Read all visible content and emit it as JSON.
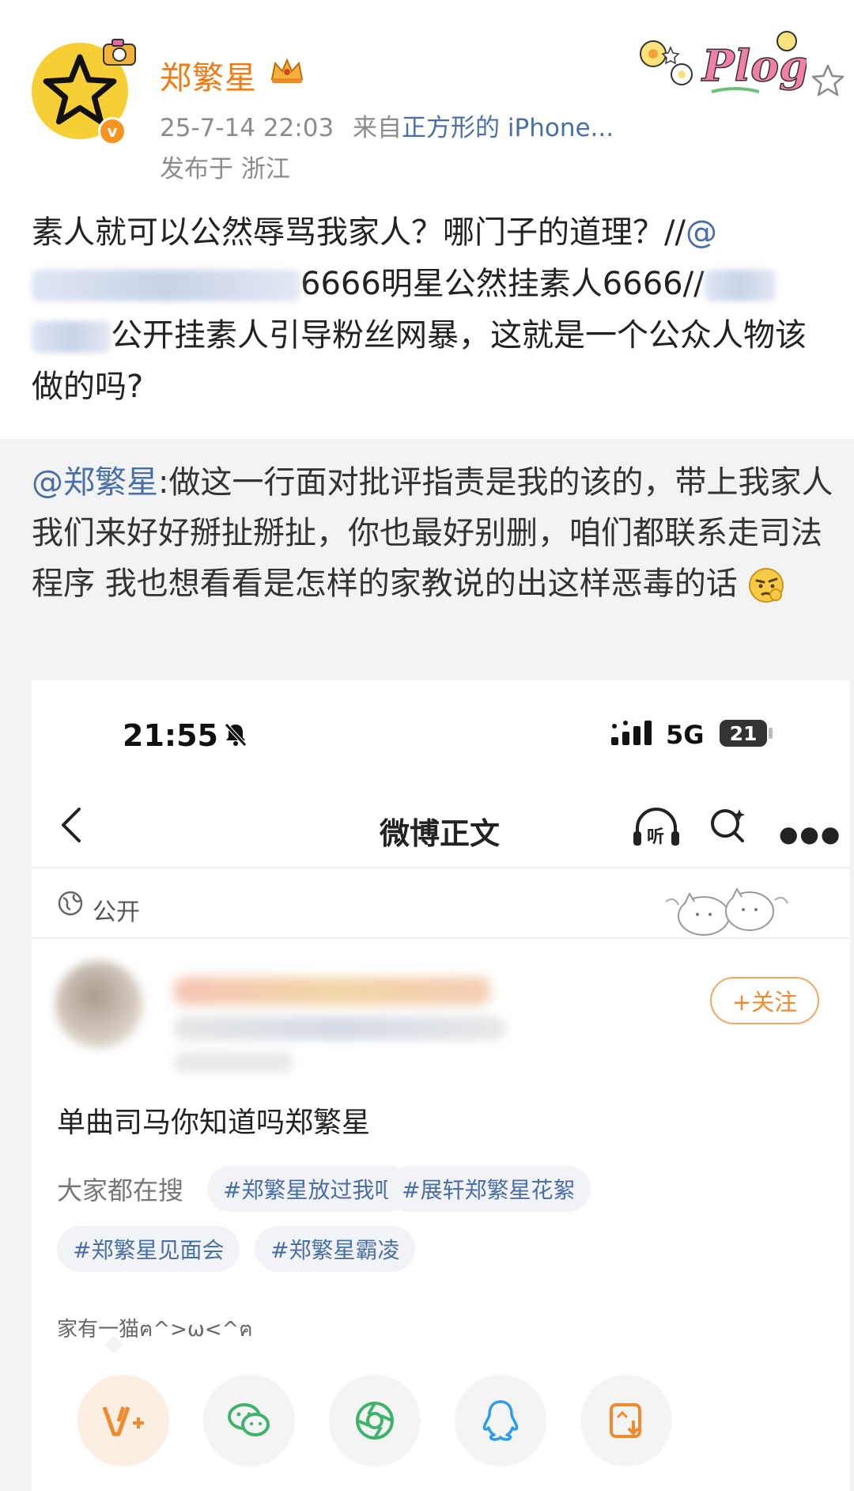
{
  "post": {
    "username": "郑繁星",
    "date": "25-7-14 22:03",
    "from_label": "来自",
    "source": "正方形的 iPhone...",
    "location": "发布于 浙江",
    "text_a": "素人就可以公然辱骂我家人？哪门子的道理？//",
    "mention_a": "@",
    "text_b": "6666明星公然挂素人6666//",
    "text_c": "公开挂素人引导粉丝网暴，这就是一个公众人物该做的吗?"
  },
  "quote": {
    "mention": "@郑繁星",
    "text": ":做这一行面对批评指责是我的该的，带上我家人我们来好好掰扯掰扯，你也最好别删，咱们都联系走司法程序 我也想看看是怎样的家教说的出这样恶毒的话"
  },
  "phone": {
    "time": "21:55",
    "network": "5G",
    "battery": "21",
    "title": "微博正文",
    "listen_label": "听",
    "visibility": "公开",
    "follow_label": "+关注",
    "post_text": "单曲司马你知道吗郑繁星",
    "searching_label": "大家都在搜",
    "tags": [
      "#郑繁星放过我吧",
      "#展轩郑繁星花絮",
      "#郑繁星见面会",
      "#郑繁星霸凌"
    ],
    "cat_line": "家有一猫ฅ^>ω<^ฅ"
  },
  "icons": {
    "avatar": "star-icon",
    "verified": "verified-badge-icon",
    "crown": "crown-icon",
    "plog": "plog-sticker-icon",
    "favorite": "star-outline-icon",
    "share": [
      "weibo-icon",
      "wechat-icon",
      "moments-icon",
      "qq-icon",
      "save-image-icon"
    ]
  },
  "colors": {
    "username": "#f07a14",
    "link": "#4a6fa5",
    "avatar_bg": "#f6cf36",
    "follow": "#f08a2e"
  }
}
